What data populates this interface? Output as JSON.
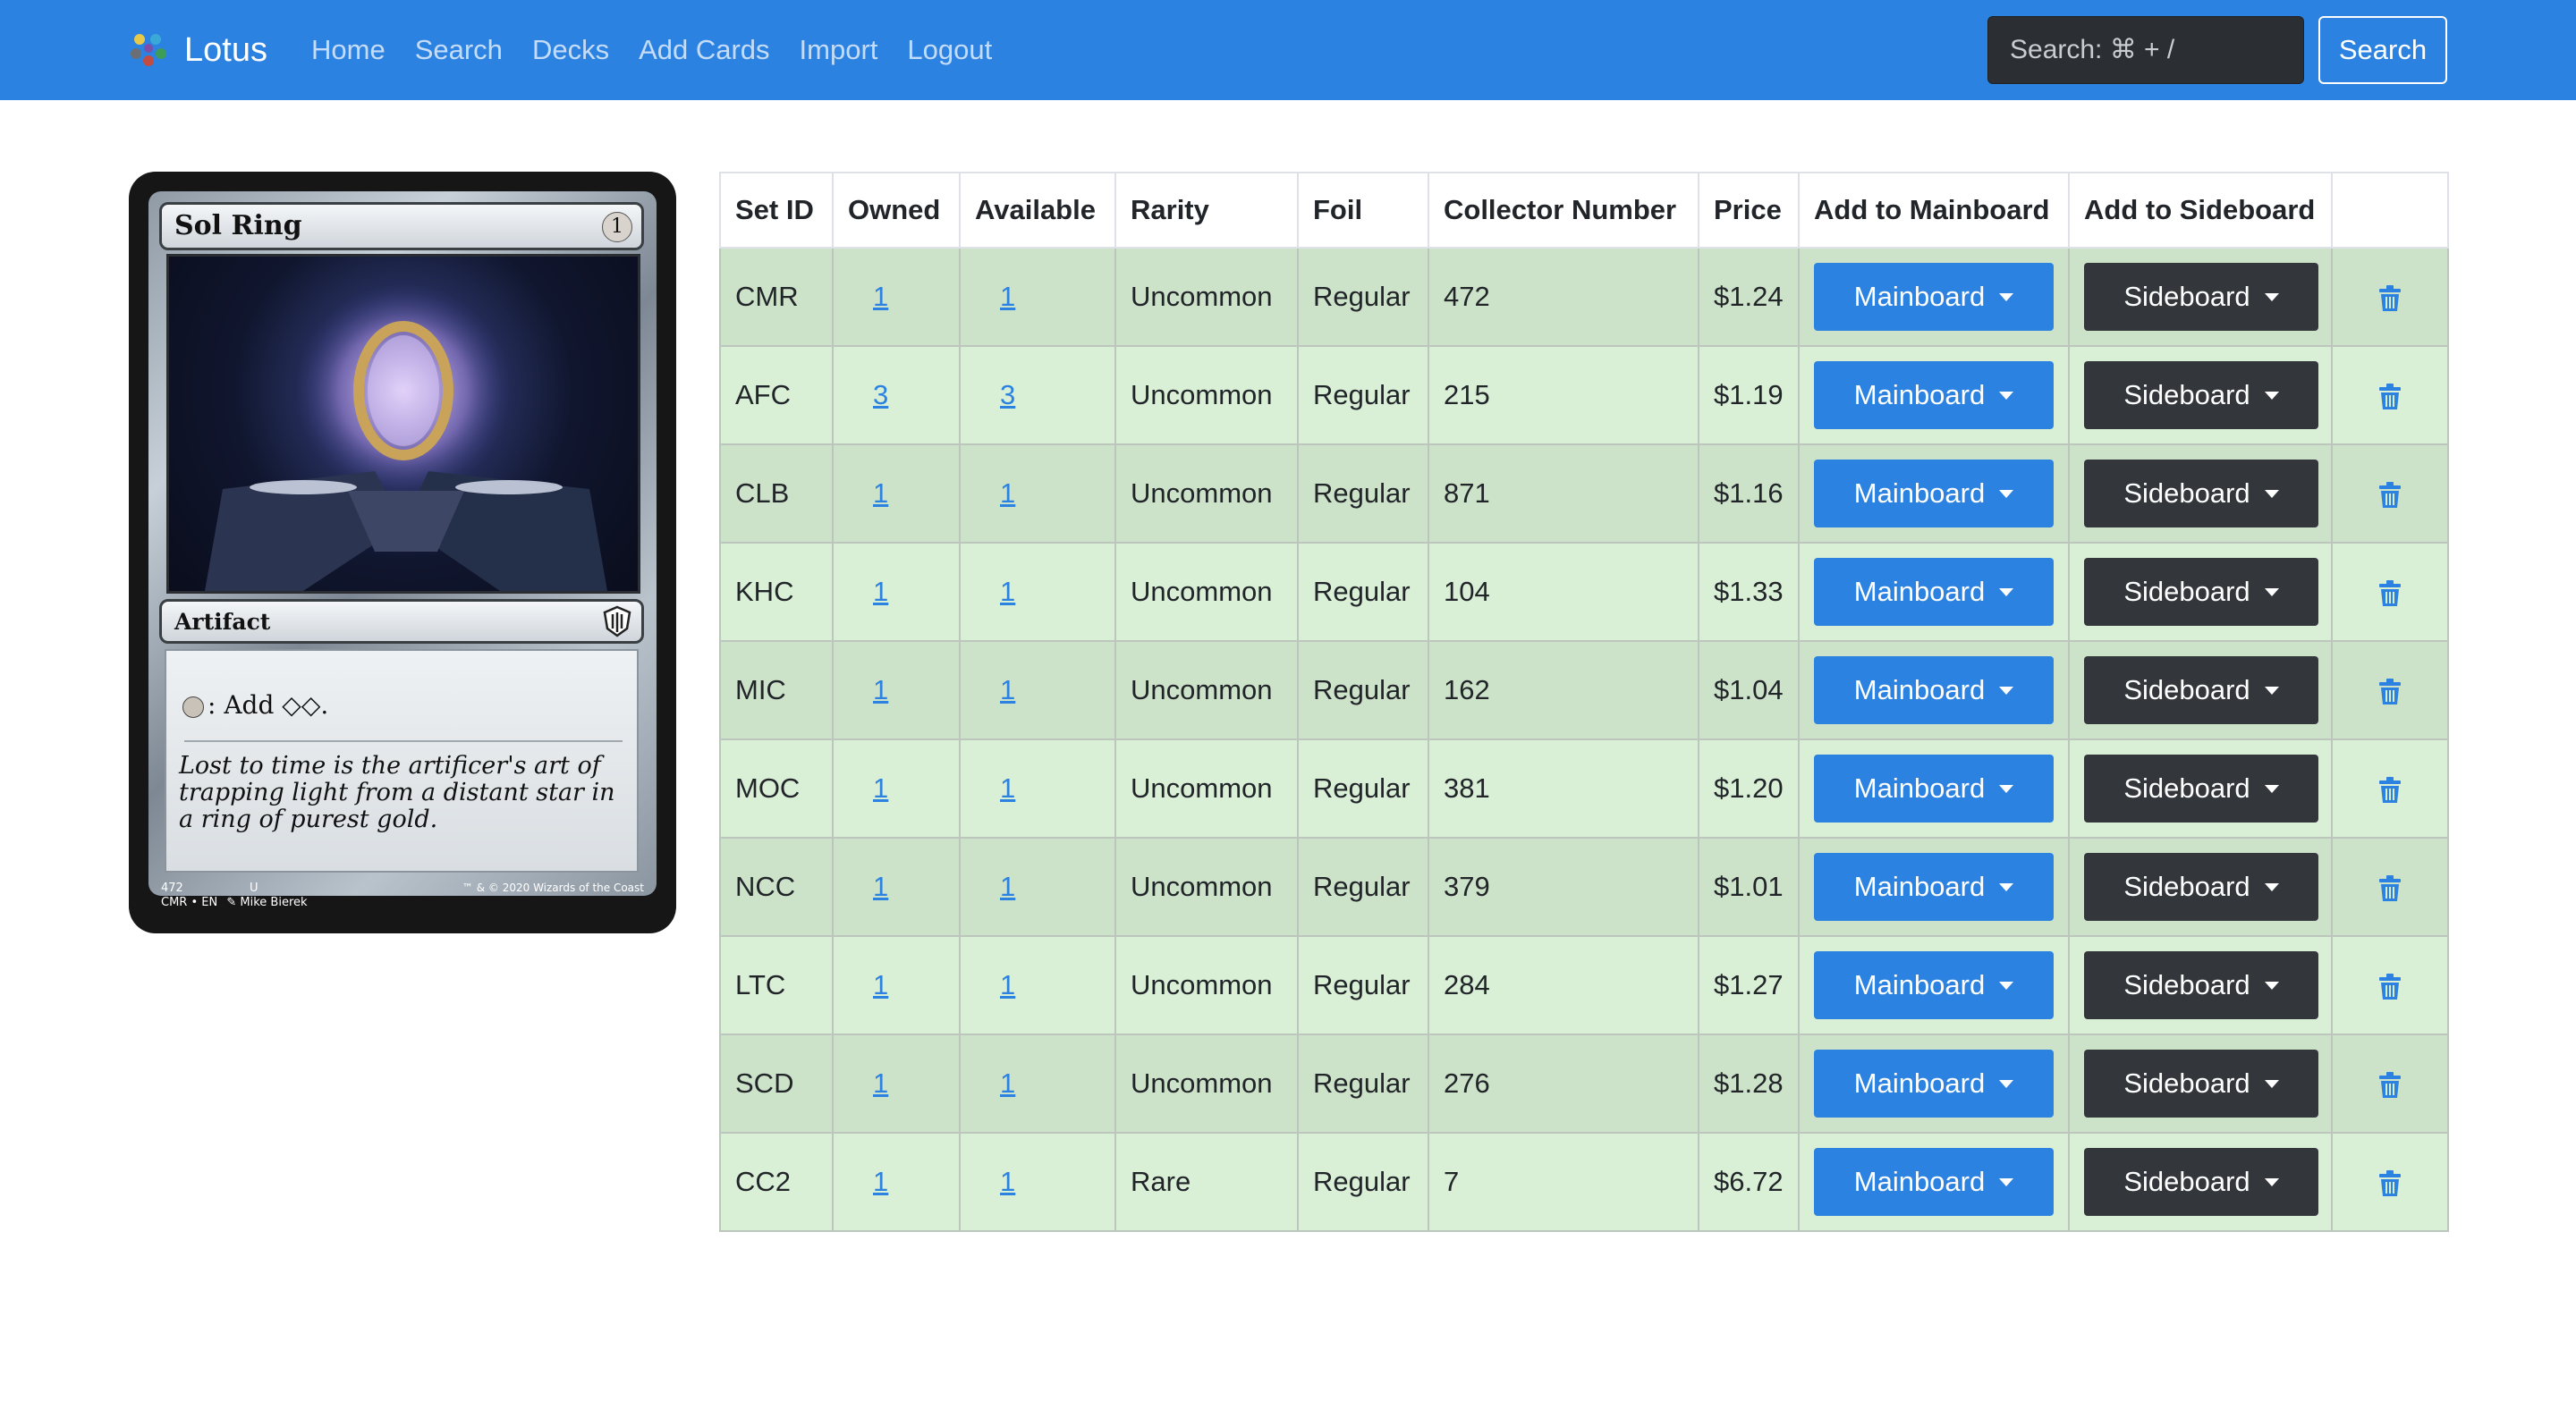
{
  "navbar": {
    "brand": "Lotus",
    "links": [
      "Home",
      "Search",
      "Decks",
      "Add Cards",
      "Import",
      "Logout"
    ],
    "search_placeholder": "Search: ⌘ + /",
    "search_button": "Search"
  },
  "card": {
    "name": "Sol Ring",
    "mana_cost": "1",
    "type_line": "Artifact",
    "rules_text": ": Add ◇◇.",
    "flavor_text": "Lost to time is the artificer's art of trapping light from a distant star in a ring of purest gold.",
    "collector_number": "472",
    "rarity_letter": "U",
    "set_lang": "CMR • EN",
    "artist": "Mike Bierek",
    "copyright": "™ & © 2020 Wizards of the Coast"
  },
  "table": {
    "headers": [
      "Set ID",
      "Owned",
      "Available",
      "Rarity",
      "Foil",
      "Collector Number",
      "Price",
      "Add to Mainboard",
      "Add to Sideboard",
      ""
    ],
    "mainboard_label": "Mainboard",
    "sideboard_label": "Sideboard",
    "rows": [
      {
        "set": "CMR",
        "owned": "1",
        "available": "1",
        "rarity": "Uncommon",
        "foil": "Regular",
        "collector": "472",
        "price": "$1.24"
      },
      {
        "set": "AFC",
        "owned": "3",
        "available": "3",
        "rarity": "Uncommon",
        "foil": "Regular",
        "collector": "215",
        "price": "$1.19"
      },
      {
        "set": "CLB",
        "owned": "1",
        "available": "1",
        "rarity": "Uncommon",
        "foil": "Regular",
        "collector": "871",
        "price": "$1.16"
      },
      {
        "set": "KHC",
        "owned": "1",
        "available": "1",
        "rarity": "Uncommon",
        "foil": "Regular",
        "collector": "104",
        "price": "$1.33"
      },
      {
        "set": "MIC",
        "owned": "1",
        "available": "1",
        "rarity": "Uncommon",
        "foil": "Regular",
        "collector": "162",
        "price": "$1.04"
      },
      {
        "set": "MOC",
        "owned": "1",
        "available": "1",
        "rarity": "Uncommon",
        "foil": "Regular",
        "collector": "381",
        "price": "$1.20"
      },
      {
        "set": "NCC",
        "owned": "1",
        "available": "1",
        "rarity": "Uncommon",
        "foil": "Regular",
        "collector": "379",
        "price": "$1.01"
      },
      {
        "set": "LTC",
        "owned": "1",
        "available": "1",
        "rarity": "Uncommon",
        "foil": "Regular",
        "collector": "284",
        "price": "$1.27"
      },
      {
        "set": "SCD",
        "owned": "1",
        "available": "1",
        "rarity": "Uncommon",
        "foil": "Regular",
        "collector": "276",
        "price": "$1.28"
      },
      {
        "set": "CC2",
        "owned": "1",
        "available": "1",
        "rarity": "Rare",
        "foil": "Regular",
        "collector": "7",
        "price": "$6.72"
      }
    ]
  },
  "colors": {
    "navbar": "#2c82e0",
    "row_dark": "#cde3c9",
    "row_light": "#d9efd6",
    "mainboard_button": "#2c82e0",
    "sideboard_button": "#33373c",
    "link": "#2c82e0"
  },
  "icons": {
    "brand": "lotus-logo-icon",
    "delete": "trash-icon",
    "dropdown": "caret-down-icon"
  }
}
